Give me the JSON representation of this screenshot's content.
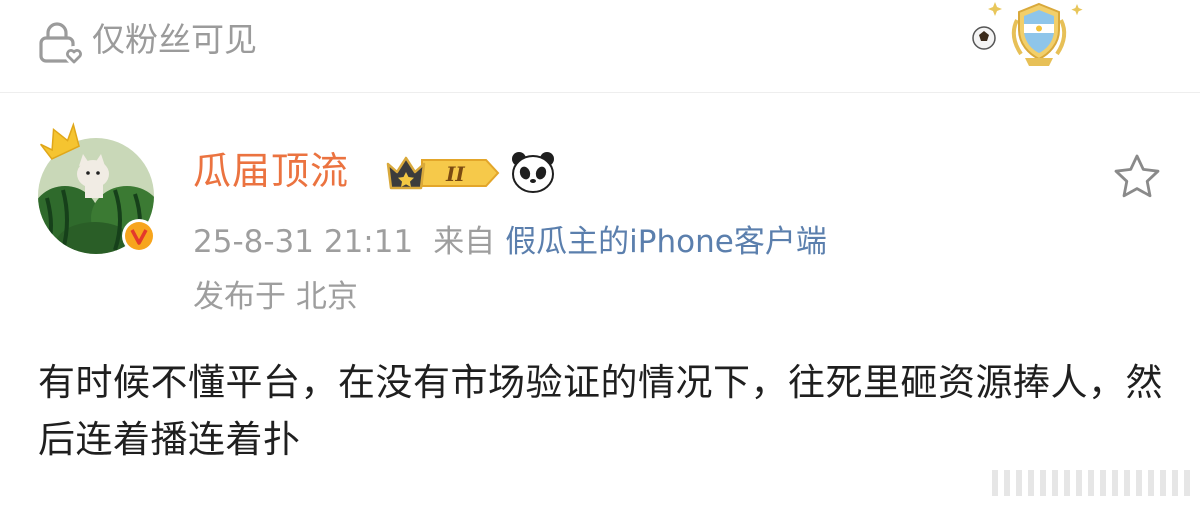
{
  "header": {
    "visibility_label": "仅粉丝可见",
    "lock_icon": "lock-heart-icon",
    "badge_icon": "argentina-football-badge-icon"
  },
  "post": {
    "author": {
      "name": "瓜届顶流",
      "avatar_icon": "cat-watermelon-avatar",
      "verified_icon": "verified-v-icon",
      "level_label": "II",
      "panda_icon": "panda-icon"
    },
    "time": "25-8-31 21:11",
    "from_prefix": "来自",
    "source": "假瓜主的iPhone客户端",
    "location": "发布于 北京",
    "content": "有时候不懂平台，在没有市场验证的情况下，往死里砸资源捧人，然后连着播连着扑",
    "favorite_icon": "star-outline-icon"
  },
  "colors": {
    "username": "#eb7340",
    "source_link": "#5b7fad",
    "meta_text": "#9e9e9e",
    "body_text": "#1f1f1f"
  }
}
